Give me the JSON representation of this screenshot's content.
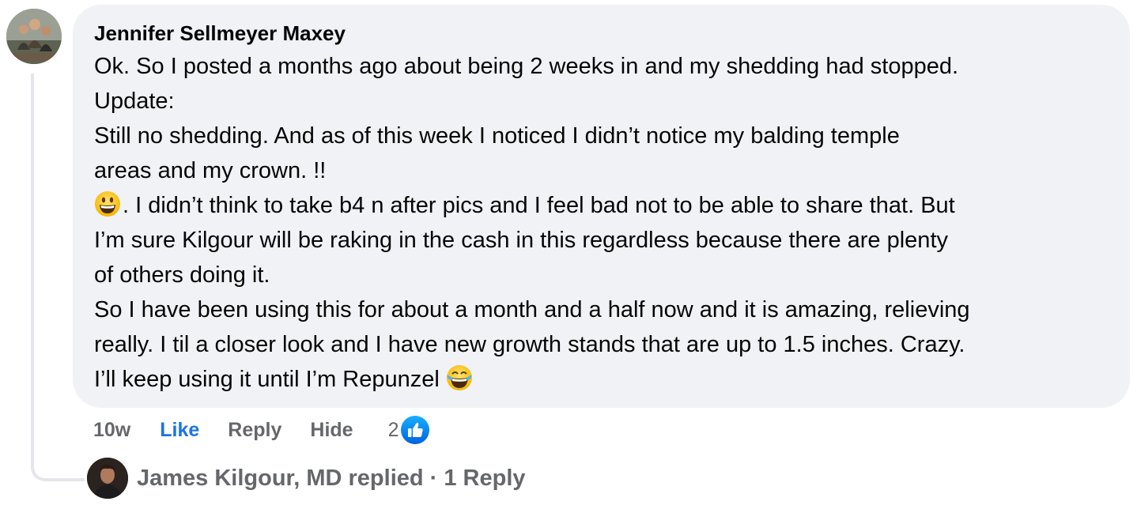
{
  "comment": {
    "author": "Jennifer Sellmeyer Maxey",
    "lines": [
      "Ok. So I posted a months ago about being 2 weeks in and my shedding had stopped.",
      "Update:",
      "Still no shedding. And as of this week I noticed I didn’t notice my balding temple",
      "areas and my crown. !!",
      ". I didn’t think to take b4 n after pics and I feel bad not to be able to share that. But",
      "I’m sure Kilgour will be raking in the cash in this regardless because there are plenty",
      "of others doing it.",
      "So I have been using this for about a month and a half now and it is amazing, relieving",
      "really. I til a closer look and I have new growth stands that are up to 1.5 inches. Crazy.",
      "I’ll keep using it until I’m Repunzel"
    ],
    "emoji_start": "grinning-face-emoji",
    "emoji_end": "face-with-tears-of-joy-emoji"
  },
  "actions": {
    "time": "10w",
    "like": "Like",
    "reply": "Reply",
    "hide": "Hide",
    "reaction_count": "2"
  },
  "replies": {
    "text": "James Kilgour, MD replied · 1 Reply"
  },
  "colors": {
    "bubble": "#f0f2f5",
    "text": "#050505",
    "secondary": "#65676b",
    "like_blue": "#1b74e4",
    "thread_line": "#e4e6eb",
    "reaction_gradient_top": "#18afff",
    "reaction_gradient_bottom": "#0062df"
  }
}
